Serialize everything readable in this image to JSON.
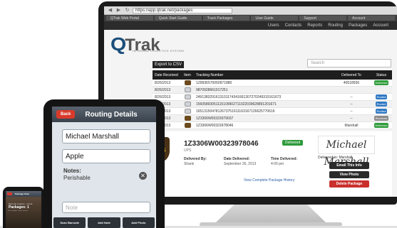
{
  "browser": {
    "url": "https://app.qtrak.net/packages",
    "tabs": [
      "QTrak Web Portal",
      "Quick Start Guide",
      "Track Packages",
      "User Guide",
      "Support",
      "Account"
    ]
  },
  "app": {
    "nav": [
      "Users",
      "Contacts",
      "Reports",
      "Routing",
      "Packages",
      "Account"
    ],
    "logo_q": "Q",
    "logo_rak": "Trak",
    "logo_sub": "INTERNAL LOGISTICS SYSTEM",
    "export_label": "Export to CSV",
    "search_placeholder": "Search",
    "table": {
      "headers": {
        "date": "Date Received",
        "icon": "Item",
        "tracking": "Tracking Number",
        "to": "Delivered To",
        "status": "Status"
      },
      "rows": [
        {
          "date": "8/26/2013",
          "carrier": "ups",
          "tracking": "1Z8936570060971880",
          "to": "40518936",
          "status": "Delivered",
          "status_color": "#2e9b3a"
        },
        {
          "date": "8/26/2013",
          "carrier": "scan",
          "tracking": "9870928661017251",
          "to": "",
          "status": "",
          "status_color": ""
        },
        {
          "date": "8/26/2013",
          "carrier": "scan",
          "tracking": "2491383291613101174341661307270249315161673",
          "to": "--",
          "status": "Routed",
          "status_color": "#2f78c4"
        },
        {
          "date": "8/26/2013",
          "carrier": "scan",
          "tracking": "15605893051115109902711022039628891201671",
          "to": "--",
          "status": "Routed",
          "status_color": "#2f78c4"
        },
        {
          "date": "8/26/2013",
          "carrier": "scan",
          "tracking": "1651315047812673751611163167126625770616",
          "to": "--",
          "status": "Routed",
          "status_color": "#2f78c4"
        },
        {
          "date": "8/26/2013",
          "carrier": "ups",
          "tracking": "1Z3306W00323979037",
          "to": "--",
          "status": "Received",
          "status_color": "#8a8a8a"
        },
        {
          "date": "8/26/2013",
          "carrier": "ups",
          "tracking": "1Z3306W00323978046",
          "to": "Marshall",
          "status": "Delivered",
          "status_color": "#2e9b3a"
        }
      ]
    },
    "detail": {
      "ups_logo": "ups",
      "tracking": "1Z3306W00323978046",
      "carrier": "UPS",
      "badge": "Delivered",
      "delivered_by_label": "Delivered By:",
      "delivered_by": "Shank",
      "date_label": "Date Delivered:",
      "date": "September 26, 2013",
      "time_label": "Time Delivered:",
      "time": "4:00 pm",
      "history_link": "View Complete Package History",
      "signature": "Michael Marshall",
      "delivered_to": "Delivered to: Marshall",
      "btn_email": "Email This Info",
      "btn_photo": "View Photo",
      "btn_delete": "Delete Package"
    }
  },
  "tablet": {
    "back": "Back",
    "title": "Routing Details",
    "name": "Michael Marshall",
    "department": "Apple",
    "notes_label": "Notes:",
    "notes_value": "Perishable",
    "note_placeholder": "Note",
    "actions": [
      "Scan Barcode",
      "Add Note",
      "Add Photo"
    ]
  },
  "phone": {
    "title": "Package Scan",
    "line1": "Barcode Capture - Count",
    "line2": "Packages: 1",
    "line3": "Scan complete - tap to continue"
  }
}
